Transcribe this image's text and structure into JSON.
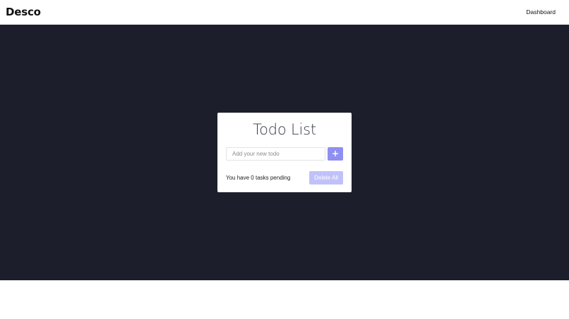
{
  "navbar": {
    "brand": "Desco",
    "links": [
      {
        "label": "Dashboard"
      }
    ]
  },
  "todo_card": {
    "title": "Todo List",
    "input": {
      "value": "",
      "placeholder": "Add your new todo"
    },
    "add_button": {
      "label": "+",
      "icon": "plus-icon",
      "color": "#8f8ff2"
    },
    "pending_text": "You have 0 tasks pending",
    "delete_all_button": {
      "label": "Delete All",
      "color": "#c1c1fa",
      "state": "disabled"
    }
  },
  "colors": {
    "hero_background": "#1c1f2b",
    "page_background": "#ffffff",
    "accent": "#8f8ff2"
  }
}
